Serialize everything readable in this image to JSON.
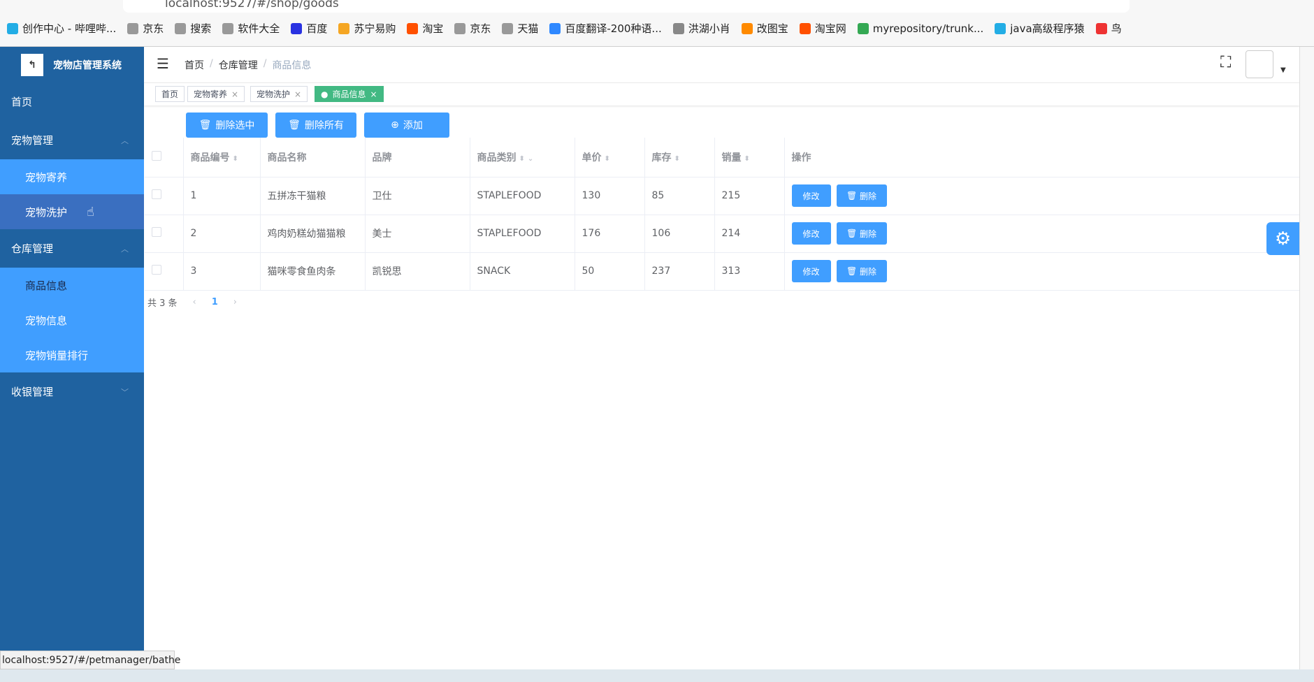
{
  "browser": {
    "url": "localhost:9527/#/shop/goods",
    "status_url": "localhost:9527/#/petmanager/bathe",
    "bookmarks": [
      {
        "label": "创作中心 - 哔哩哔...",
        "color": "#23ade5"
      },
      {
        "label": "京东",
        "color": "#999"
      },
      {
        "label": "搜索",
        "color": "#999"
      },
      {
        "label": "软件大全",
        "color": "#999"
      },
      {
        "label": "百度",
        "color": "#2932e1"
      },
      {
        "label": "苏宁易购",
        "color": "#f5a623"
      },
      {
        "label": "淘宝",
        "color": "#ff5000"
      },
      {
        "label": "京东",
        "color": "#999"
      },
      {
        "label": "天猫",
        "color": "#999"
      },
      {
        "label": "百度翻译-200种语...",
        "color": "#2f88ff"
      },
      {
        "label": "洪湖小肖",
        "color": "#888"
      },
      {
        "label": "改图宝",
        "color": "#ff8a00"
      },
      {
        "label": "淘宝网",
        "color": "#ff5000"
      },
      {
        "label": "myrepository/trunk...",
        "color": "#34a853"
      },
      {
        "label": "java高级程序猿",
        "color": "#23ade5"
      },
      {
        "label": "鸟",
        "color": "#e33"
      }
    ]
  },
  "sidebar": {
    "title": "宠物店管理系统",
    "home": "首页",
    "groups": [
      {
        "label": "宠物管理",
        "items": [
          "宠物寄养",
          "宠物洗护"
        ]
      },
      {
        "label": "仓库管理",
        "items": [
          "商品信息",
          "宠物信息",
          "宠物销量排行"
        ]
      },
      {
        "label": "收银管理",
        "items": []
      }
    ]
  },
  "breadcrumb": [
    "首页",
    "仓库管理",
    "商品信息"
  ],
  "tags": [
    {
      "label": "首页"
    },
    {
      "label": "宠物寄养"
    },
    {
      "label": "宠物洗护"
    },
    {
      "label": "商品信息"
    }
  ],
  "toolbar": {
    "delete_selected": "删除选中",
    "delete_all": "删除所有",
    "add": "添加"
  },
  "table": {
    "headers": [
      "商品编号",
      "商品名称",
      "品牌",
      "商品类别",
      "单价",
      "库存",
      "销量",
      "操作"
    ],
    "rows": [
      [
        "1",
        "五拼冻干猫粮",
        "卫仕",
        "STAPLEFOOD",
        "130",
        "85",
        "215"
      ],
      [
        "2",
        "鸡肉奶糕幼猫猫粮",
        "美士",
        "STAPLEFOOD",
        "176",
        "106",
        "214"
      ],
      [
        "3",
        "猫咪零食鱼肉条",
        "凯锐思",
        "SNACK",
        "50",
        "237",
        "313"
      ]
    ],
    "edit": "修改",
    "delete": "删除"
  },
  "pagination": {
    "total": "共 3 条",
    "page": "1"
  }
}
